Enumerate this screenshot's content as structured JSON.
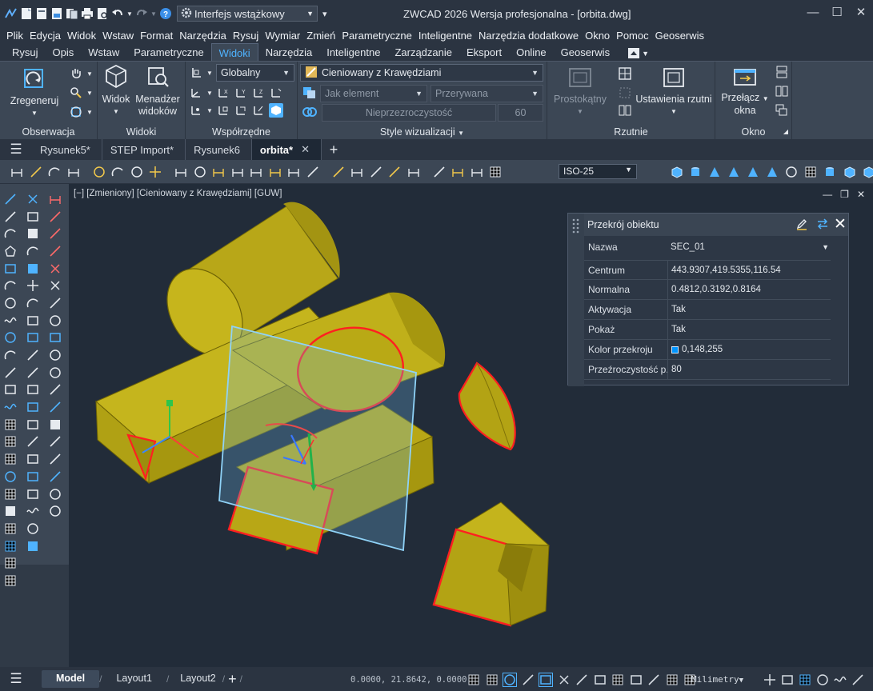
{
  "window": {
    "title": "ZWCAD 2026 Wersja profesjonalna - [orbita.dwg]",
    "workspace": "Interfejs wstążkowy"
  },
  "menu": [
    "Plik",
    "Edycja",
    "Widok",
    "Wstaw",
    "Format",
    "Narzędzia",
    "Rysuj",
    "Wymiar",
    "Zmień",
    "Parametryczne",
    "Inteligentne",
    "Narzędzia dodatkowe",
    "Okno",
    "Pomoc",
    "Geoserwis"
  ],
  "ribbon_tabs": [
    "Rysuj",
    "Opis",
    "Wstaw",
    "Parametryczne",
    "Widoki",
    "Narzędzia",
    "Inteligentne",
    "Zarządzanie",
    "Eksport",
    "Online",
    "Geoserwis"
  ],
  "ribbon_active_tab": "Widoki",
  "ribbon": {
    "observation": {
      "title": "Obserwacja",
      "regen": "Zregeneruj"
    },
    "views": {
      "title": "Widoki",
      "view": "Widok",
      "manager_line1": "Menadżer",
      "manager_line2": "widoków"
    },
    "coords": {
      "title": "Współrzędne",
      "ucs": "Globalny"
    },
    "visual": {
      "title": "Style wizualizacji",
      "style": "Cieniowany z Krawędziami",
      "element": "Jak element",
      "linetype": "Przerywana",
      "transparency_label": "Nieprzezroczystość",
      "transparency_value": "60"
    },
    "viewports": {
      "title": "Rzutnie",
      "rect": "Prostokątny",
      "settings": "Ustawienia rzutni"
    },
    "window": {
      "title": "Okno",
      "switch_line1": "Przełącz",
      "switch_line2": "okna"
    }
  },
  "doc_tabs": [
    {
      "label": "Rysunek5*",
      "active": false
    },
    {
      "label": "STEP Import*",
      "active": false
    },
    {
      "label": "Rysunek6",
      "active": false
    },
    {
      "label": "orbita*",
      "active": true
    }
  ],
  "dimstyle": "ISO-25",
  "viewport_label": "[−] [Zmieniony] [Cieniowany z Krawędziami] [GUW]",
  "palette": {
    "title": "Przekrój obiektu",
    "name_label": "Nazwa",
    "name_value": "SEC_01",
    "rows": [
      {
        "label": "Centrum",
        "value": "443.9307,419.5355,116.54"
      },
      {
        "label": "Normalna",
        "value": "0.4812,0.3192,0.8164"
      },
      {
        "label": "Aktywacja",
        "value": "Tak"
      },
      {
        "label": "Pokaż",
        "value": "Tak"
      },
      {
        "label": "Kolor przekroju",
        "value": "0,148,255"
      },
      {
        "label": "Przeźroczystość p...",
        "value": "80"
      }
    ],
    "section_color": "#0094ff"
  },
  "status": {
    "layouts": [
      "Model",
      "Layout1",
      "Layout2"
    ],
    "coords": "0.0000, 21.8642, 0.0000",
    "units": "Milimetry"
  },
  "colors": {
    "accent": "#4fb3ff",
    "solid": "#c8b91c",
    "section_edge": "#ff1e1e",
    "plane": "#7fc6ef"
  }
}
